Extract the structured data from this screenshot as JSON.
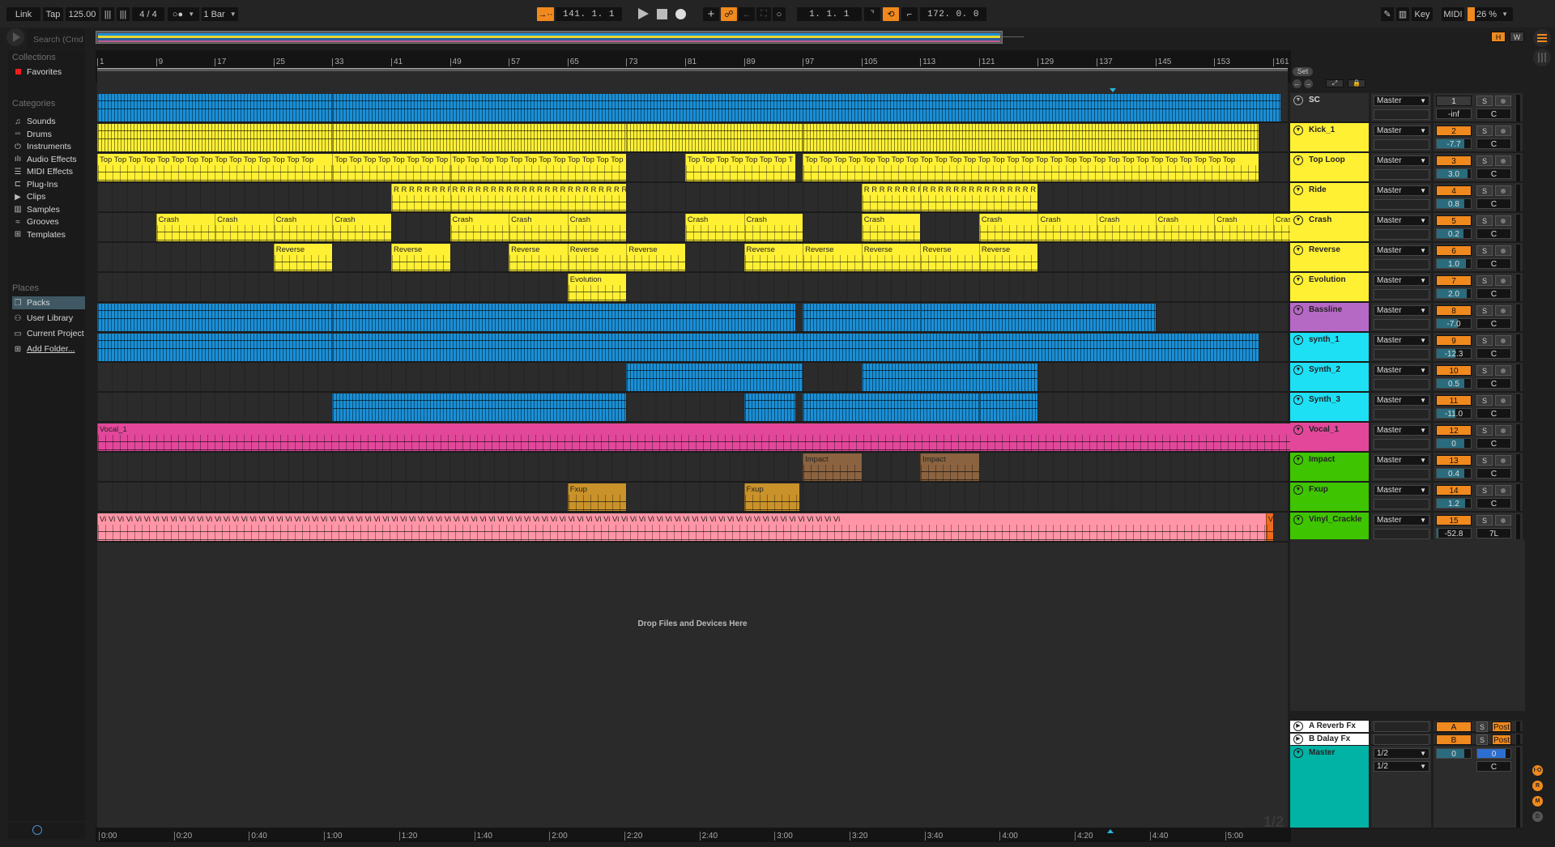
{
  "topbar": {
    "link": "Link",
    "tap": "Tap",
    "tempo": "125.00",
    "time_sig": "4 / 4",
    "metronome": "○●",
    "quantize": "1 Bar",
    "arrangement_position": "141.  1.  1",
    "loop_start": "1.  1.  1",
    "loop_length": "172.  0.  0",
    "key": "Key",
    "midi": "MIDI",
    "cpu": "26 %",
    "h_button": "H",
    "w_button": "W"
  },
  "browser": {
    "search_placeholder": "Search (Cmd",
    "collections_header": "Collections",
    "favorites": "Favorites",
    "categories_header": "Categories",
    "categories": [
      {
        "label": "Sounds",
        "icon": "♫"
      },
      {
        "label": "Drums",
        "icon": "▫▫"
      },
      {
        "label": "Instruments",
        "icon": "⏻"
      },
      {
        "label": "Audio Effects",
        "icon": "ıIı"
      },
      {
        "label": "MIDI Effects",
        "icon": "☰"
      },
      {
        "label": "Plug-Ins",
        "icon": "⊏"
      },
      {
        "label": "Clips",
        "icon": "▶"
      },
      {
        "label": "Samples",
        "icon": "▥"
      },
      {
        "label": "Grooves",
        "icon": "≈"
      },
      {
        "label": "Templates",
        "icon": "⊞"
      }
    ],
    "places_header": "Places",
    "places": [
      {
        "label": "Packs",
        "icon": "❐",
        "selected": true
      },
      {
        "label": "User Library",
        "icon": "⚇"
      },
      {
        "label": "Current Project",
        "icon": "▭"
      },
      {
        "label": "Add Folder...",
        "icon": "⊞"
      }
    ]
  },
  "ruler": {
    "bars": [
      "1",
      "9",
      "17",
      "25",
      "33",
      "41",
      "49",
      "57",
      "65",
      "73",
      "81",
      "89",
      "97",
      "105",
      "113",
      "121",
      "129",
      "137",
      "145",
      "153",
      "161"
    ],
    "set_label": "Set",
    "times": [
      "0:00",
      "0:20",
      "0:40",
      "1:00",
      "1:20",
      "1:40",
      "2:00",
      "2:20",
      "2:40",
      "3:00",
      "3:20",
      "3:40",
      "4:00",
      "4:20",
      "4:40",
      "5:00"
    ]
  },
  "drop_hint": "Drop Files and Devices Here",
  "page_indicator": "1/2",
  "colors": {
    "accent": "#f0891e",
    "yellow": "#fff034",
    "blue": "#1a8fd6",
    "purple": "#b668c5",
    "cyan": "#1ee0f5",
    "pink": "#e2479a",
    "green": "#3ec400",
    "teal": "#00b3a5"
  },
  "tracks": [
    {
      "name": "SC",
      "color": "#2b2b2b",
      "output": "Master",
      "num": "1",
      "num_active": false,
      "volume": "-inf",
      "volume_fill": 0,
      "pan": "C",
      "clips": [
        {
          "start": 1,
          "end": 33,
          "label": "",
          "color": "#1a8fd6",
          "dense": true
        },
        {
          "start": 33,
          "end": 162,
          "label": "",
          "color": "#1a8fd6",
          "dense": true
        }
      ]
    },
    {
      "name": "Kick_1",
      "color": "#fff034",
      "output": "Master",
      "num": "2",
      "num_active": true,
      "volume": "-7.7",
      "volume_fill": 0.8,
      "pan": "C",
      "clips": [
        {
          "start": 1,
          "end": 33,
          "label": "",
          "color": "#fff034",
          "dense": true
        },
        {
          "start": 33,
          "end": 73,
          "label": "",
          "color": "#fff034",
          "dense": true
        },
        {
          "start": 73,
          "end": 97,
          "label": "",
          "color": "#fff034",
          "dense": true
        },
        {
          "start": 97,
          "end": 159,
          "label": "",
          "color": "#fff034",
          "dense": true
        }
      ]
    },
    {
      "name": "Top Loop",
      "color": "#fff034",
      "output": "Master",
      "num": "3",
      "num_active": true,
      "volume": "3.0",
      "volume_fill": 0.9,
      "pan": "C",
      "clips": [
        {
          "start": 1,
          "end": 33,
          "label": "Top Top Top Top Top Top Top Top Top Top Top Top Top Top Top",
          "color": "#fff034"
        },
        {
          "start": 33,
          "end": 49,
          "label": "Top Top Top Top Top Top Top Top",
          "color": "#fff034"
        },
        {
          "start": 49,
          "end": 73,
          "label": "Top Top Top Top Top Top Top Top Top Top Top Top",
          "color": "#fff034"
        },
        {
          "start": 81,
          "end": 96,
          "label": "Top Top Top Top Top Top Top T",
          "color": "#fff034"
        },
        {
          "start": 97,
          "end": 159,
          "label": "Top Top Top Top Top Top Top Top Top Top Top Top Top Top Top Top Top Top Top Top Top Top Top Top Top Top Top Top Top Top",
          "color": "#fff034"
        }
      ]
    },
    {
      "name": "Ride",
      "color": "#fff034",
      "output": "Master",
      "num": "4",
      "num_active": true,
      "volume": "0.8",
      "volume_fill": 0.8,
      "pan": "C",
      "clips": [
        {
          "start": 41,
          "end": 49,
          "label": "R R R R R R R R",
          "color": "#fff034"
        },
        {
          "start": 49,
          "end": 73,
          "label": "R R R R R R R R R R R R R R R R R R R R R R R R",
          "color": "#fff034"
        },
        {
          "start": 105,
          "end": 113,
          "label": "R R R R R R R R",
          "color": "#fff034"
        },
        {
          "start": 113,
          "end": 129,
          "label": "R R R R R R R R R R R R R R R R",
          "color": "#fff034"
        }
      ]
    },
    {
      "name": "Crash",
      "color": "#fff034",
      "output": "Master",
      "num": "5",
      "num_active": true,
      "volume": "0.2",
      "volume_fill": 0.78,
      "pan": "C",
      "clips": [
        {
          "start": 9,
          "end": 17,
          "label": "Crash",
          "color": "#fff034"
        },
        {
          "start": 17,
          "end": 25,
          "label": "Crash",
          "color": "#fff034"
        },
        {
          "start": 25,
          "end": 33,
          "label": "Crash",
          "color": "#fff034"
        },
        {
          "start": 33,
          "end": 41,
          "label": "Crash",
          "color": "#fff034"
        },
        {
          "start": 49,
          "end": 57,
          "label": "Crash",
          "color": "#fff034"
        },
        {
          "start": 57,
          "end": 65,
          "label": "Crash",
          "color": "#fff034"
        },
        {
          "start": 65,
          "end": 73,
          "label": "Crash",
          "color": "#fff034"
        },
        {
          "start": 81,
          "end": 89,
          "label": "Crash",
          "color": "#fff034"
        },
        {
          "start": 89,
          "end": 97,
          "label": "Crash",
          "color": "#fff034"
        },
        {
          "start": 105,
          "end": 113,
          "label": "Crash",
          "color": "#fff034"
        },
        {
          "start": 121,
          "end": 129,
          "label": "Crash",
          "color": "#fff034"
        },
        {
          "start": 129,
          "end": 137,
          "label": "Crash",
          "color": "#fff034"
        },
        {
          "start": 137,
          "end": 145,
          "label": "Crash",
          "color": "#fff034"
        },
        {
          "start": 145,
          "end": 153,
          "label": "Crash",
          "color": "#fff034"
        },
        {
          "start": 153,
          "end": 161,
          "label": "Crash",
          "color": "#fff034"
        },
        {
          "start": 161,
          "end": 166,
          "label": "Crash",
          "color": "#fff034"
        }
      ]
    },
    {
      "name": "Reverse",
      "color": "#fff034",
      "output": "Master",
      "num": "6",
      "num_active": true,
      "volume": "1.0",
      "volume_fill": 0.85,
      "pan": "C",
      "clips": [
        {
          "start": 25,
          "end": 33,
          "label": "Reverse",
          "color": "#fff034"
        },
        {
          "start": 41,
          "end": 49,
          "label": "Reverse",
          "color": "#fff034"
        },
        {
          "start": 57,
          "end": 65,
          "label": "Reverse",
          "color": "#fff034"
        },
        {
          "start": 65,
          "end": 73,
          "label": "Reverse",
          "color": "#fff034"
        },
        {
          "start": 73,
          "end": 81,
          "label": "Reverse",
          "color": "#fff034"
        },
        {
          "start": 89,
          "end": 97,
          "label": "Reverse",
          "color": "#fff034"
        },
        {
          "start": 97,
          "end": 105,
          "label": "Reverse",
          "color": "#fff034"
        },
        {
          "start": 105,
          "end": 113,
          "label": "Reverse",
          "color": "#fff034"
        },
        {
          "start": 113,
          "end": 121,
          "label": "Reverse",
          "color": "#fff034"
        },
        {
          "start": 121,
          "end": 129,
          "label": "Reverse",
          "color": "#fff034"
        }
      ]
    },
    {
      "name": "Evolution",
      "color": "#fff034",
      "output": "Master",
      "num": "7",
      "num_active": true,
      "volume": "2.0",
      "volume_fill": 0.88,
      "pan": "C",
      "clips": [
        {
          "start": 65,
          "end": 73,
          "label": "Evolution",
          "color": "#fff034"
        }
      ]
    },
    {
      "name": "Bassline",
      "color": "#b668c5",
      "output": "Master",
      "num": "8",
      "num_active": true,
      "volume": "-7.0",
      "volume_fill": 0.62,
      "pan": "C",
      "clips": [
        {
          "start": 1,
          "end": 33,
          "label": "",
          "color": "#1a8fd6",
          "dense": true
        },
        {
          "start": 33,
          "end": 96,
          "label": "",
          "color": "#1a8fd6",
          "dense": true
        },
        {
          "start": 97,
          "end": 113,
          "label": "",
          "color": "#1a8fd6",
          "dense": true
        },
        {
          "start": 113,
          "end": 145,
          "label": "",
          "color": "#1a8fd6",
          "dense": true
        }
      ]
    },
    {
      "name": "synth_1",
      "color": "#1ee0f5",
      "output": "Master",
      "num": "9",
      "num_active": true,
      "volume": "-12.3",
      "volume_fill": 0.55,
      "pan": "C",
      "clips": [
        {
          "start": 1,
          "end": 33,
          "label": "",
          "color": "#1a8fd6",
          "dense": true
        },
        {
          "start": 33,
          "end": 97,
          "label": "",
          "color": "#1a8fd6",
          "dense": true
        },
        {
          "start": 97,
          "end": 121,
          "label": "",
          "color": "#1a8fd6",
          "dense": true
        },
        {
          "start": 121,
          "end": 159,
          "label": "",
          "color": "#1a8fd6",
          "dense": true
        }
      ]
    },
    {
      "name": "Synth_2",
      "color": "#1ee0f5",
      "output": "Master",
      "num": "10",
      "num_active": true,
      "volume": "0.5",
      "volume_fill": 0.8,
      "pan": "C",
      "clips": [
        {
          "start": 73,
          "end": 97,
          "label": "",
          "color": "#1a8fd6",
          "dense": true
        },
        {
          "start": 105,
          "end": 129,
          "label": "",
          "color": "#1a8fd6",
          "dense": true
        }
      ]
    },
    {
      "name": "Synth_3",
      "color": "#1ee0f5",
      "output": "Master",
      "num": "11",
      "num_active": true,
      "volume": "-11.0",
      "volume_fill": 0.55,
      "pan": "C",
      "clips": [
        {
          "start": 33,
          "end": 73,
          "label": "",
          "color": "#1a8fd6",
          "dense": true
        },
        {
          "start": 89,
          "end": 96,
          "label": "",
          "color": "#1a8fd6",
          "dense": true
        },
        {
          "start": 97,
          "end": 121,
          "label": "",
          "color": "#1a8fd6",
          "dense": true
        },
        {
          "start": 121,
          "end": 129,
          "label": "",
          "color": "#1a8fd6",
          "dense": true
        }
      ]
    },
    {
      "name": "Vocal_1",
      "color": "#e2479a",
      "output": "Master",
      "num": "12",
      "num_active": true,
      "volume": "0",
      "volume_fill": 0.82,
      "pan": "C",
      "clips": [
        {
          "start": 1,
          "end": 166,
          "label": "Vocal_1",
          "color": "#e2479a"
        }
      ]
    },
    {
      "name": "Impact",
      "color": "#3ec400",
      "output": "Master",
      "num": "13",
      "num_active": true,
      "volume": "0.4",
      "volume_fill": 0.8,
      "pan": "C",
      "clips": [
        {
          "start": 97,
          "end": 105,
          "label": "Impact",
          "color": "#8b6340"
        },
        {
          "start": 113,
          "end": 121,
          "label": "Impact",
          "color": "#8b6340"
        }
      ]
    },
    {
      "name": "Fxup",
      "color": "#3ec400",
      "output": "Master",
      "num": "14",
      "num_active": true,
      "volume": "1.2",
      "volume_fill": 0.84,
      "pan": "C",
      "clips": [
        {
          "start": 65,
          "end": 73,
          "label": "Fxup",
          "color": "#c9922a"
        },
        {
          "start": 89,
          "end": 96.5,
          "label": "Fxup",
          "color": "#c9922a"
        }
      ]
    },
    {
      "name": "Vinyl_Crackle",
      "color": "#3ec400",
      "output": "Master",
      "num": "15",
      "num_active": true,
      "volume": "-52.8",
      "volume_fill": 0.05,
      "pan": "7L",
      "clips": [
        {
          "start": 1,
          "end": 160,
          "label": "Vi Vi Vi Vi Vi Vi Vi Vi Vi Vi Vi Vi Vi Vi Vi Vi Vi Vi Vi Vi Vi Vi Vi Vi Vi Vi Vi Vi Vi Vi Vi Vi Vi Vi Vi Vi Vi Vi Vi Vi Vi Vi Vi Vi Vi Vi Vi Vi Vi Vi Vi Vi Vi Vi Vi Vi Vi Vi Vi Vi Vi Vi Vi Vi Vi Vi Vi Vi Vi Vi Vi Vi Vi Vi Vi Vi Vi Vi Vi Vi Vi Vi Vi Vi",
          "color": "#ff95a6"
        },
        {
          "start": 160,
          "end": 161,
          "label": "Vi",
          "color": "#f06a1e"
        }
      ]
    }
  ],
  "returns": [
    {
      "name": "A Reverb Fx",
      "letter": "A",
      "send_mode": "Post"
    },
    {
      "name": "B Dalay Fx",
      "letter": "B",
      "send_mode": "Post"
    }
  ],
  "master": {
    "name": "Master",
    "input": "1/2",
    "output": "1/2",
    "volume": "0",
    "cue": "0",
    "pan": "C"
  },
  "side_buttons": [
    "I·O",
    "R",
    "M",
    "D"
  ]
}
